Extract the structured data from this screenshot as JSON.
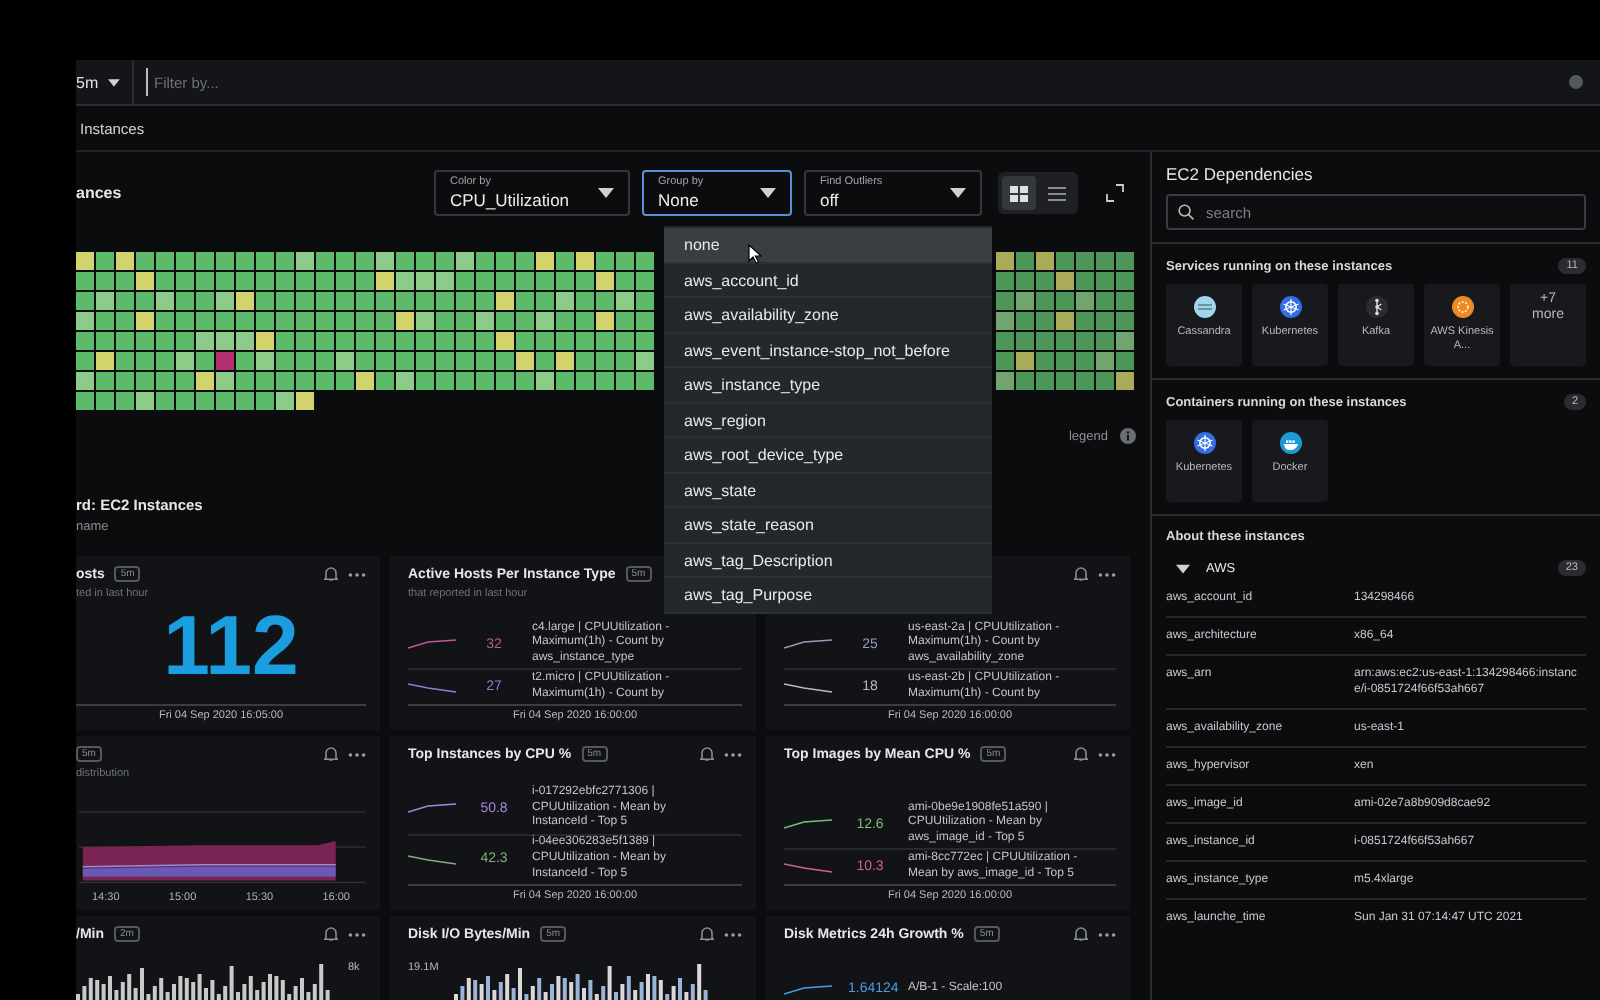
{
  "topbar": {
    "time_range": "5m",
    "filter": {
      "placeholder": "Filter by..."
    }
  },
  "breadcrumb": "Instances",
  "toolbar": {
    "title": "ances",
    "selects": [
      {
        "label": "Color by",
        "value": "CPU_Utilization",
        "open": false
      },
      {
        "label": "Group by",
        "value": "None",
        "open": true
      },
      {
        "label": "Find Outliers",
        "value": "off",
        "open": false
      }
    ],
    "views": [
      {
        "kind": "grid",
        "selected": true
      },
      {
        "kind": "list",
        "selected": false
      }
    ]
  },
  "group_menu": {
    "items": [
      {
        "label": "none",
        "selected": true
      },
      {
        "label": "aws_account_id",
        "selected": false
      },
      {
        "label": "aws_availability_zone",
        "selected": false
      },
      {
        "label": "aws_event_instance-stop_not_before",
        "selected": false
      },
      {
        "label": "aws_instance_type",
        "selected": false
      },
      {
        "label": "aws_region",
        "selected": false
      },
      {
        "label": "aws_root_device_type",
        "selected": false
      },
      {
        "label": "aws_state",
        "selected": false
      },
      {
        "label": "aws_state_reason",
        "selected": false
      },
      {
        "label": "aws_tag_Description",
        "selected": false
      },
      {
        "label": "aws_tag_Purpose",
        "selected": false
      }
    ]
  },
  "heatmap": {
    "legend": "legend"
  },
  "dashboard": {
    "title": "rd: EC2 Instances",
    "subtitle": "name"
  },
  "cards": [
    {
      "kind": "number",
      "actions": true,
      "title": "osts",
      "badge": "5m",
      "subtitle": "ted in last hour",
      "value": "112",
      "date": "Fri 04 Sep 2020 16:05:00"
    },
    {
      "kind": "list",
      "title": "Active Hosts Per Instance Type",
      "badge": "5m",
      "subtitle": "that reported in last hour",
      "entries": [
        {
          "value": "32",
          "text": "c4.large | CPUUtilization - Maximum(1h) - Count by aws_instance_type",
          "color": "#c0589a"
        },
        {
          "value": "27",
          "text": "t2.micro | CPUUtilization - Maximum(1h) - Count by",
          "color": "#8a7fd8"
        }
      ],
      "date": "Fri 04 Sep 2020 16:00:00"
    },
    {
      "kind": "list",
      "actions": true,
      "entries": [
        {
          "value": "25",
          "text": "us-east-2a | CPUUtilization - Maximum(1h) - Count by aws_availability_zone",
          "color": "#9a9ab8"
        },
        {
          "value": "18",
          "text": "us-east-2b | CPUUtilization - Maximum(1h) - Count by",
          "color": "#b8b8c8"
        }
      ],
      "date": "Fri 04 Sep 2020 16:00:00"
    },
    {
      "kind": "area",
      "actions": true,
      "badge": "5m",
      "subtitle": "distribution",
      "x_labels": [
        "14:30",
        "15:00",
        "15:30",
        "16:00"
      ]
    },
    {
      "kind": "list",
      "actions": true,
      "title": "Top Instances by CPU %",
      "badge": "5m",
      "entries": [
        {
          "value": "50.8",
          "text": "i-017292ebfc2771306 | CPUUtilization - Mean by InstanceId - Top 5",
          "color": "#a884e0"
        },
        {
          "value": "42.3",
          "text": "i-04ee306283e5f1389 | CPUUtilization - Mean by InstanceId - Top 5",
          "color": "#7fae7a"
        }
      ],
      "date": "Fri 04 Sep 2020 16:00:00"
    },
    {
      "kind": "list",
      "actions": true,
      "title": "Top Images by Mean CPU %",
      "badge": "5m",
      "entries": [
        {
          "value": "12.6",
          "text": "ami-0be9e1908fe51a590 | CPUUtilization - Mean by aws_image_id - Top 5",
          "color": "#78c07a"
        },
        {
          "value": "10.3",
          "text": "ami-8cc772ec | CPUUtilization - Mean by aws_image_id - Top 5",
          "color": "#d0609a"
        }
      ],
      "date": "Fri 04 Sep 2020 16:00:00"
    },
    {
      "kind": "bars",
      "actions": true,
      "title": "/Min",
      "badge": "2m",
      "axis_value": "8k"
    },
    {
      "kind": "dualbars",
      "actions": true,
      "title": "Disk I/O Bytes/Min",
      "badge": "5m",
      "axis_value": "19.1M"
    },
    {
      "kind": "list",
      "actions": true,
      "title": "Disk Metrics 24h Growth %",
      "badge": "5m",
      "entries": [
        {
          "value": "1.64124",
          "text": "A/B-1 - Scale:100",
          "color": "#4a9ee0"
        }
      ]
    }
  ],
  "dependencies": {
    "title": "EC2 Dependencies",
    "search": {
      "placeholder": "search"
    },
    "sections": [
      {
        "title": "Services running on these instances",
        "count": "11",
        "tiles": [
          {
            "label": "Cassandra",
            "kind": "cassandra"
          },
          {
            "label": "Kubernetes",
            "kind": "kubernetes"
          },
          {
            "label": "Kafka",
            "kind": "kafka"
          },
          {
            "label": "AWS Kinesis A...",
            "kind": "kinesis"
          },
          {
            "label": "+7 more",
            "kind": "more"
          }
        ]
      },
      {
        "title": "Containers running on these instances",
        "count": "2",
        "tiles": [
          {
            "label": "Kubernetes",
            "kind": "kubernetes"
          },
          {
            "label": "Docker",
            "kind": "docker"
          }
        ]
      }
    ],
    "about": {
      "title": "About these instances",
      "group": {
        "label": "AWS",
        "count": "23",
        "expanded": true,
        "rows": [
          {
            "key": "aws_account_id",
            "value": "134298466"
          },
          {
            "key": "aws_architecture",
            "value": "x86_64"
          },
          {
            "key": "aws_arn",
            "value": "arn:aws:ec2:us-east-1:134298466:instance/i-0851724f66f53ah667"
          },
          {
            "key": "aws_availability_zone",
            "value": "us-east-1"
          },
          {
            "key": "aws_hypervisor",
            "value": "xen"
          },
          {
            "key": "aws_image_id",
            "value": "ami-02e7a8b909d8cae92"
          },
          {
            "key": "aws_instance_id",
            "value": "i-0851724f66f53ah667"
          },
          {
            "key": "aws_instance_type",
            "value": "m5.4xlarge"
          },
          {
            "key": "aws_launche_time",
            "value": "Sun Jan 31 07:14:47 UTC 2021"
          }
        ]
      }
    }
  }
}
